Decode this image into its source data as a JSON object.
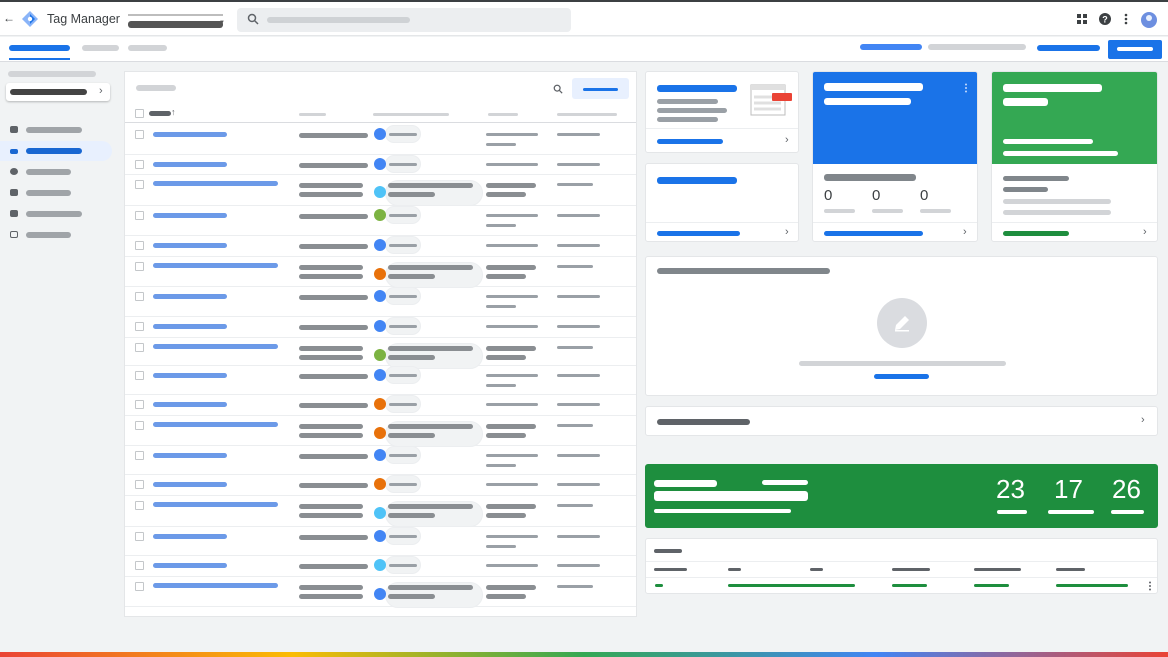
{
  "app": {
    "title": "Tag Manager",
    "back_icon": "back-arrow-icon"
  },
  "colors": {
    "blue": "#1a73e8",
    "green": "#34a853",
    "dark_green": "#1e8e3e",
    "orange": "#e8710a",
    "light_blue": "#4fc3f7",
    "light_green": "#7cb342",
    "red": "#ea4335",
    "placeholder_gray": "#9aa0a6"
  },
  "icons": [
    "search-icon",
    "apps-grid-icon",
    "help-icon",
    "more-vert-icon",
    "account-avatar-icon",
    "edit-pencil-icon",
    "chevron-right-icon"
  ],
  "tag_rows": [
    {
      "color": "#4285f4",
      "tall": false
    },
    {
      "color": "#4285f4",
      "tall": false
    },
    {
      "color": "#4fc3f7",
      "tall": true
    },
    {
      "color": "#7cb342",
      "tall": false
    },
    {
      "color": "#4285f4",
      "tall": false
    },
    {
      "color": "#e8710a",
      "tall": true
    },
    {
      "color": "#4285f4",
      "tall": false
    },
    {
      "color": "#4285f4",
      "tall": false
    },
    {
      "color": "#7cb342",
      "tall": true
    },
    {
      "color": "#4285f4",
      "tall": false
    },
    {
      "color": "#e8710a",
      "tall": false
    },
    {
      "color": "#e8710a",
      "tall": true
    },
    {
      "color": "#4285f4",
      "tall": false
    },
    {
      "color": "#e8710a",
      "tall": false
    },
    {
      "color": "#4fc3f7",
      "tall": true
    },
    {
      "color": "#4285f4",
      "tall": false
    },
    {
      "color": "#4fc3f7",
      "tall": false
    },
    {
      "color": "#4285f4",
      "tall": true
    }
  ],
  "blue_card": {
    "stats": [
      "0",
      "0",
      "0"
    ]
  },
  "summary_banner": {
    "stats": [
      "23",
      "17",
      "26"
    ]
  }
}
